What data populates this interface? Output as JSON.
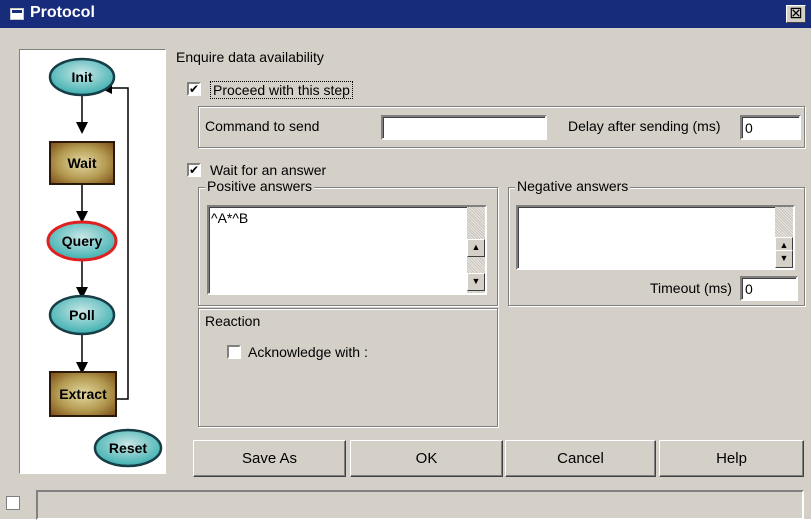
{
  "window": {
    "title": "Protocol",
    "close_glyph": "⊠"
  },
  "flow": {
    "nodes": [
      {
        "label": "Init",
        "shape": "ellipse",
        "fill": "#3dafb0"
      },
      {
        "label": "Wait",
        "shape": "box",
        "fill": "#8c5a1e"
      },
      {
        "label": "Query",
        "shape": "ellipse",
        "fill": "#3dafb0",
        "selected": true,
        "outline": "#e02020"
      },
      {
        "label": "Poll",
        "shape": "ellipse",
        "fill": "#3dafb0"
      },
      {
        "label": "Extract",
        "shape": "box",
        "fill": "#8c5a1e"
      },
      {
        "label": "Reset",
        "shape": "ellipse",
        "fill": "#3dafb0"
      }
    ]
  },
  "step": {
    "heading": "Enquire data availability",
    "proceed": {
      "label": "Proceed with this step",
      "checked": true,
      "mark": "✔"
    },
    "command": {
      "label": "Command to send",
      "value": ""
    },
    "delay": {
      "label": "Delay after sending (ms)",
      "value": "0"
    },
    "wait_answer": {
      "label": "Wait for an answer",
      "checked": true,
      "mark": "✔"
    },
    "positive": {
      "title": "Positive answers",
      "lines": [
        "^A*^B"
      ]
    },
    "negative": {
      "title": "Negative answers",
      "lines": []
    },
    "timeout": {
      "label": "Timeout (ms)",
      "value": "0"
    },
    "reaction": {
      "title": "Reaction",
      "acknowledge": {
        "label": "Acknowledge with :",
        "checked": false
      }
    }
  },
  "buttons": {
    "save_as": "Save As",
    "ok": "OK",
    "cancel": "Cancel",
    "help": "Help"
  },
  "scroll": {
    "up": "▲",
    "down": "▼"
  }
}
